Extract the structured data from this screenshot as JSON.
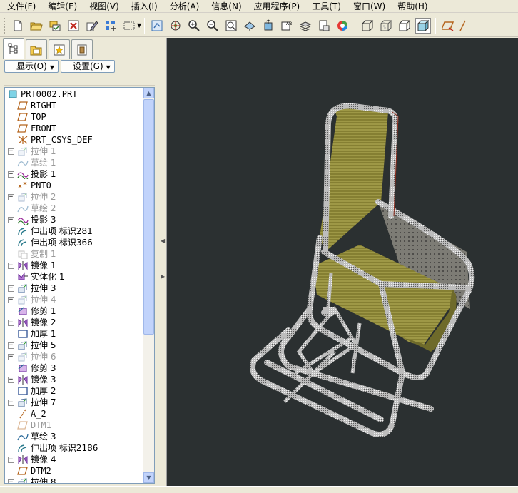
{
  "menu": [
    "文件(F)",
    "编辑(E)",
    "视图(V)",
    "插入(I)",
    "分析(A)",
    "信息(N)",
    "应用程序(P)",
    "工具(T)",
    "窗口(W)",
    "帮助(H)"
  ],
  "toolbar": {
    "icons": [
      "new-file-icon",
      "open-folder-icon",
      "save-icon",
      "close-window-icon",
      "edit-icon",
      "regenerate-icon",
      "select-box-icon",
      "redraw-icon",
      "spin-center-icon",
      "zoom-in-icon",
      "zoom-out-icon",
      "refit-icon",
      "orient-icon",
      "view-manager-icon",
      "layers-icon",
      "model-tree-icon",
      "appearance-icon",
      "wireframe-icon",
      "hidden-line-icon",
      "no-hidden-icon",
      "shading-icon",
      "datum-plane-icon"
    ]
  },
  "panel": {
    "show_button": "显示(O)",
    "settings_button": "设置(G)"
  },
  "tree": {
    "root": "PRT0002.PRT",
    "items": [
      {
        "label": "RIGHT",
        "icon": "datum-plane",
        "expand": false,
        "dim": false
      },
      {
        "label": "TOP",
        "icon": "datum-plane",
        "expand": false,
        "dim": false
      },
      {
        "label": "FRONT",
        "icon": "datum-plane",
        "expand": false,
        "dim": false
      },
      {
        "label": "PRT_CSYS_DEF",
        "icon": "csys",
        "expand": false,
        "dim": false
      },
      {
        "label": "拉伸 1",
        "icon": "extrude",
        "expand": true,
        "dim": true
      },
      {
        "label": "草绘 1",
        "icon": "sketch",
        "expand": false,
        "dim": true
      },
      {
        "label": "投影 1",
        "icon": "projection",
        "expand": true,
        "dim": false
      },
      {
        "label": "PNT0",
        "icon": "point",
        "expand": false,
        "dim": false
      },
      {
        "label": "拉伸 2",
        "icon": "extrude",
        "expand": true,
        "dim": true
      },
      {
        "label": "草绘 2",
        "icon": "sketch",
        "expand": false,
        "dim": true
      },
      {
        "label": "投影 3",
        "icon": "projection",
        "expand": true,
        "dim": false
      },
      {
        "label": "伸出项 标识281",
        "icon": "protrusion",
        "expand": false,
        "dim": false
      },
      {
        "label": "伸出项 标识366",
        "icon": "protrusion",
        "expand": false,
        "dim": false
      },
      {
        "label": "复制 1",
        "icon": "copy",
        "expand": false,
        "dim": true
      },
      {
        "label": "镜像 1",
        "icon": "mirror",
        "expand": true,
        "dim": false
      },
      {
        "label": "实体化 1",
        "icon": "solidify",
        "expand": false,
        "dim": false
      },
      {
        "label": "拉伸 3",
        "icon": "extrude",
        "expand": true,
        "dim": false
      },
      {
        "label": "拉伸 4",
        "icon": "extrude",
        "expand": true,
        "dim": true
      },
      {
        "label": "修剪 1",
        "icon": "trim",
        "expand": false,
        "dim": false
      },
      {
        "label": "镜像 2",
        "icon": "mirror",
        "expand": true,
        "dim": false
      },
      {
        "label": "加厚 1",
        "icon": "thicken",
        "expand": false,
        "dim": false
      },
      {
        "label": "拉伸 5",
        "icon": "extrude",
        "expand": true,
        "dim": false
      },
      {
        "label": "拉伸 6",
        "icon": "extrude",
        "expand": true,
        "dim": true
      },
      {
        "label": "修剪 3",
        "icon": "trim",
        "expand": false,
        "dim": false
      },
      {
        "label": "镜像 3",
        "icon": "mirror",
        "expand": true,
        "dim": false
      },
      {
        "label": "加厚 2",
        "icon": "thicken",
        "expand": false,
        "dim": false
      },
      {
        "label": "拉伸 7",
        "icon": "extrude",
        "expand": true,
        "dim": false
      },
      {
        "label": "A_2",
        "icon": "axis",
        "expand": false,
        "dim": false
      },
      {
        "label": "DTM1",
        "icon": "datum-plane",
        "expand": false,
        "dim": true
      },
      {
        "label": "草绘 3",
        "icon": "sketch",
        "expand": false,
        "dim": false
      },
      {
        "label": "伸出项 标识2186",
        "icon": "protrusion",
        "expand": false,
        "dim": false
      },
      {
        "label": "镜像 4",
        "icon": "mirror",
        "expand": true,
        "dim": false
      },
      {
        "label": "DTM2",
        "icon": "datum-plane",
        "expand": false,
        "dim": false
      },
      {
        "label": "拉伸 8",
        "icon": "extrude",
        "expand": true,
        "dim": false
      }
    ]
  },
  "colors": {
    "viewport_bg": "#2b3031",
    "frame_metal": "#b5b5b5",
    "seat_fabric": "#8c8a3a"
  }
}
